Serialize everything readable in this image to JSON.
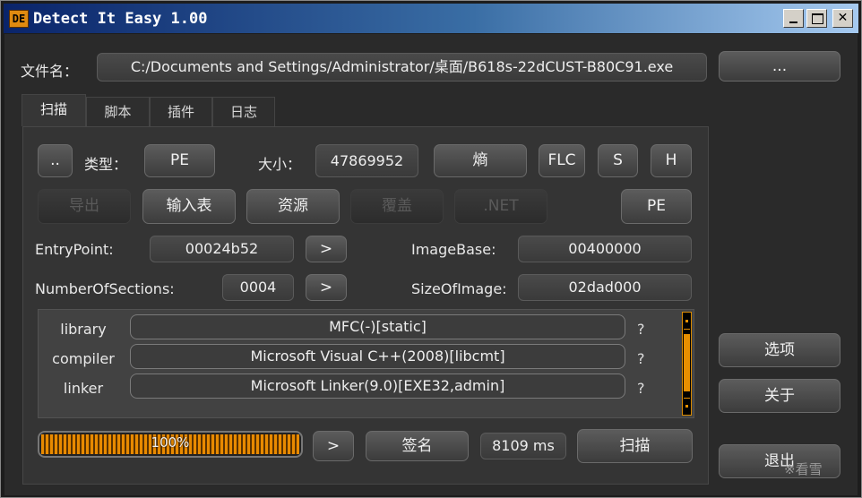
{
  "window": {
    "icon_text": "DE",
    "title": "Detect It Easy 1.00",
    "close_glyph": "✕"
  },
  "file": {
    "label": "文件名：",
    "path": "C:/Documents and Settings/Administrator/桌面/B618s-22dCUST-B80C91.exe",
    "browse_label": "..."
  },
  "tabs": [
    {
      "label": "扫描",
      "active": true
    },
    {
      "label": "脚本",
      "active": false
    },
    {
      "label": "插件",
      "active": false
    },
    {
      "label": "日志",
      "active": false
    }
  ],
  "info": {
    "dots_label": "..",
    "type_label": "类型：",
    "type_value": "PE",
    "size_label": "大小：",
    "size_value": "47869952",
    "entropy_label": "熵",
    "flc_label": "FLC",
    "s_label": "S",
    "h_label": "H"
  },
  "actions": {
    "export_label": "导出",
    "imports_label": "输入表",
    "resources_label": "资源",
    "overlay_label": "覆盖",
    "net_label": ".NET",
    "pe_label": "PE"
  },
  "pe_fields": {
    "entry_point_label": "EntryPoint:",
    "entry_point_value": "00024b52",
    "image_base_label": "ImageBase:",
    "image_base_value": "00400000",
    "sections_label": "NumberOfSections:",
    "sections_value": "0004",
    "size_of_image_label": "SizeOfImage:",
    "size_of_image_value": "02dad000",
    "goto_label": ">"
  },
  "signatures": [
    {
      "type": "library",
      "value": "MFC(-)[static]",
      "q": "?"
    },
    {
      "type": "compiler",
      "value": "Microsoft Visual C++(2008)[libcmt]",
      "q": "?"
    },
    {
      "type": "linker",
      "value": "Microsoft Linker(9.0)[EXE32,admin]",
      "q": "?"
    }
  ],
  "bottom": {
    "progress_text": "100%",
    "progress_value": 1.0,
    "next_label": ">",
    "sign_label": "签名",
    "time_value": "8109 ms",
    "scan_label": "扫描"
  },
  "side": {
    "options_label": "选项",
    "about_label": "关于",
    "exit_label": "退出"
  },
  "watermark": "※看雪",
  "colors": {
    "accent": "#e88a00",
    "background": "#2a2a2a"
  }
}
